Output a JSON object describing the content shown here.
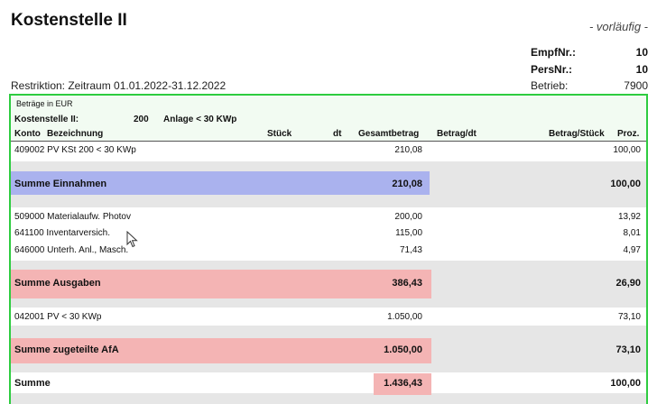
{
  "header": {
    "title": "Kostenstelle II",
    "status": "- vorläufig -",
    "empf_label": "EmpfNr.:",
    "empf_value": "10",
    "pers_label": "PersNr.:",
    "pers_value": "10",
    "restriction": "Restriktion: Zeitraum 01.01.2022-31.12.2022",
    "betrieb_label": "Betrieb:",
    "betrieb_value": "7900"
  },
  "panel": {
    "currency": "Beträge in EUR",
    "ks_label": "Kostenstelle II:",
    "ks_number": "200",
    "ks_name": "Anlage < 30 KWp",
    "columns": {
      "konto": "Konto",
      "bezeichnung": "Bezeichnung",
      "stueck": "Stück",
      "dt": "dt",
      "gesamtbetrag": "Gesamtbetrag",
      "betrag_dt": "Betrag/dt",
      "betrag_stueck": "Betrag/Stück",
      "proz": "Proz."
    }
  },
  "rows": {
    "r1": {
      "text": "409002 PV KSt 200 < 30 KWp",
      "amount": "210,08",
      "pct": "100,00"
    },
    "s1": {
      "label": "Summe Einnahmen",
      "amount": "210,08",
      "pct": "100,00"
    },
    "r2": {
      "text": "509000 Materialaufw. Photov",
      "amount": "200,00",
      "pct": "13,92"
    },
    "r3": {
      "text": "641100 Inventarversich.",
      "amount": "115,00",
      "pct": "8,01"
    },
    "r4": {
      "text": "646000 Unterh. Anl., Masch.",
      "amount": "71,43",
      "pct": "4,97"
    },
    "s2": {
      "label": "Summe Ausgaben",
      "amount": "386,43",
      "pct": "26,90"
    },
    "r5": {
      "text": "042001 PV < 30 KWp",
      "amount": "1.050,00",
      "pct": "73,10"
    },
    "s3": {
      "label": "Summe zugeteilte AfA",
      "amount": "1.050,00",
      "pct": "73,10"
    },
    "s4": {
      "label": "Summe",
      "amount": "1.436,43",
      "pct": "100,00"
    }
  },
  "colors": {
    "panel_border": "#2ecc40",
    "income_highlight": "#aab2ee",
    "expense_highlight": "#f4b4b4"
  }
}
